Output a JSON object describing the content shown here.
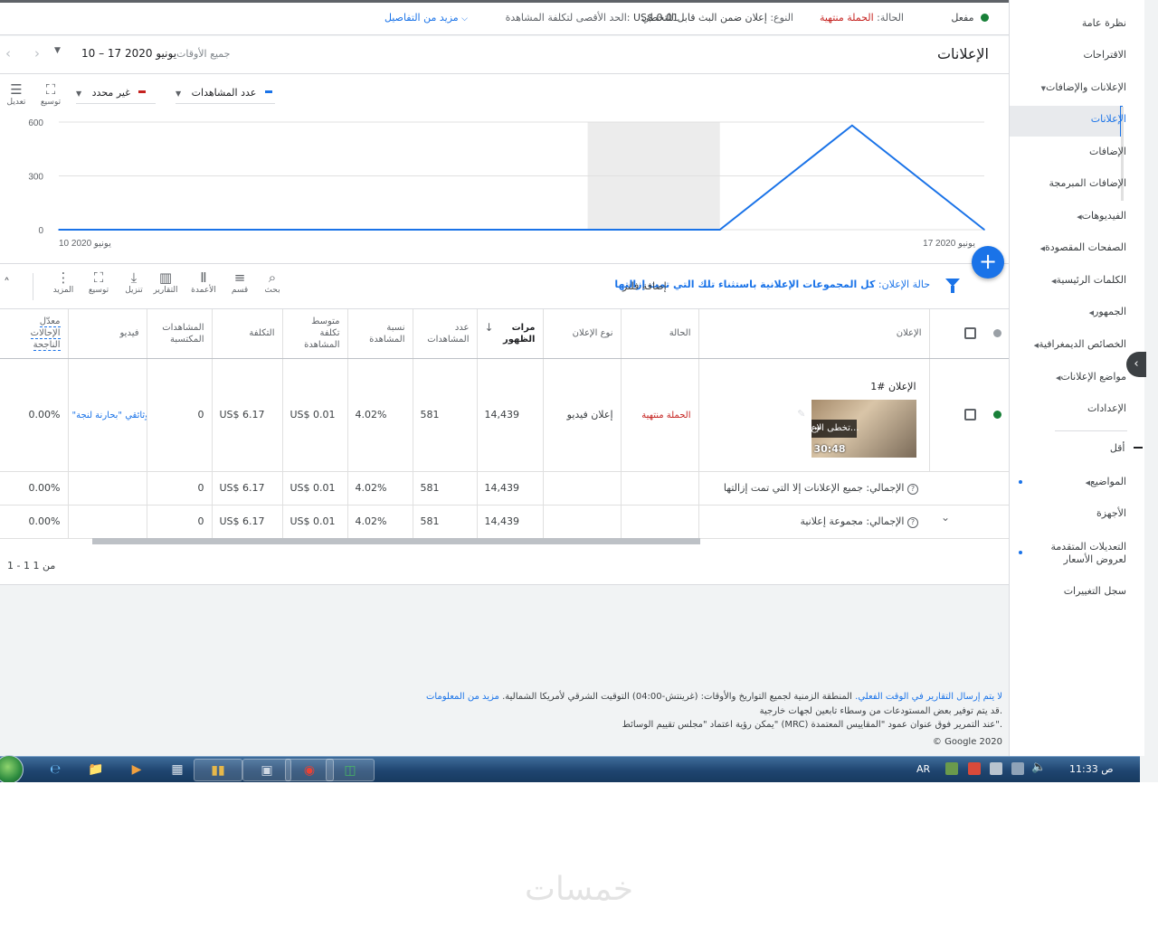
{
  "statusbar": {
    "status_label": "مفعل",
    "state_label": "الحالة:",
    "state_value": "الحملة منتهية",
    "type_label": "النوع:",
    "type_value": "إعلان ضمن البث قابل للتخطي",
    "max_cpv_label": "الحد الأقصى لتكلفة المشاهدة:",
    "max_cpv_value": "US$ 0.01",
    "more_details": "مزيد من التفاصيل"
  },
  "header": {
    "title": "الإعلانات",
    "date_preset": "جميع الأوقات",
    "date_range": "10 – 17 يونيو 2020"
  },
  "sidebar": {
    "items": [
      {
        "label": "نظرة عامة",
        "arrow": false
      },
      {
        "label": "الاقتراحات",
        "arrow": false
      },
      {
        "label": "الإعلانات والإضافات",
        "arrow": true
      },
      {
        "label": "الإعلانات",
        "arrow": false
      },
      {
        "label": "الإضافات",
        "arrow": false
      },
      {
        "label": "الإضافات المبرمجة",
        "arrow": false
      },
      {
        "label": "الفيديوهات",
        "arrow": true
      },
      {
        "label": "الصفحات المقصودة",
        "arrow": true
      },
      {
        "label": "الكلمات الرئيسية",
        "arrow": true
      },
      {
        "label": "الجمهور",
        "arrow": true
      },
      {
        "label": "الخصائص الديمغرافية",
        "arrow": true
      },
      {
        "label": "مواضع الإعلانات",
        "arrow": true
      },
      {
        "label": "الإعدادات",
        "arrow": false
      }
    ],
    "less": "أقل",
    "lower_items": [
      {
        "label": "المواضيع",
        "arrow": true
      },
      {
        "label": "الأجهزة",
        "arrow": false
      },
      {
        "label": "التعديلات المتقدمة",
        "arrow": false
      },
      {
        "label": "سجل التغييرات",
        "arrow": false
      }
    ],
    "advanced_line2": "لعروض الأسعار"
  },
  "chart_toolbar": {
    "metric1": "عدد المشاهدات",
    "metric1_color": "#1a73e8",
    "metric2": "غير محدد",
    "metric2_color": "#c5221f",
    "expand_label": "توسيع",
    "adjust_label": "تعديل"
  },
  "chart_data": {
    "type": "line",
    "x": [
      "10 يونيو 2020",
      "11 يونيو 2020",
      "12 يونيو 2020",
      "13 يونيو 2020",
      "14 يونيو 2020",
      "15 يونيو 2020",
      "16 يونيو 2020",
      "17 يونيو 2020"
    ],
    "series": [
      {
        "name": "عدد المشاهدات",
        "values": [
          0,
          0,
          0,
          0,
          0,
          0,
          581,
          0
        ]
      }
    ],
    "yticks": [
      0,
      300,
      600
    ],
    "ylim": [
      0,
      600
    ],
    "x_first_label": "10 يونيو 2020",
    "x_last_label": "17 يونيو 2020",
    "highlight_band": [
      "14 يونيو 2020",
      "15 يونيو 2020"
    ],
    "grid": true
  },
  "table_toolbar": {
    "filter_key": "حالة الإعلان:",
    "filter_value": "كل المجموعات الإعلانية باستثناء تلك التي تمت إزالتها",
    "add_filter": "إضافة فلتر",
    "tools": [
      {
        "label": "بحث",
        "icon": "search-icon"
      },
      {
        "label": "قسم",
        "icon": "segment-icon"
      },
      {
        "label": "الأعمدة",
        "icon": "columns-icon"
      },
      {
        "label": "التقارير",
        "icon": "reports-icon"
      },
      {
        "label": "تنزيل",
        "icon": "download-icon"
      },
      {
        "label": "توسيع",
        "icon": "expand-icon"
      },
      {
        "label": "المزيد",
        "icon": "more-icon"
      }
    ]
  },
  "table": {
    "columns": [
      "الإعلان",
      "الحالة",
      "نوع الإعلان",
      "مرات الظهور",
      "عدد المشاهدات",
      "نسبة المشاهدة",
      "متوسط تكلفة المشاهدة",
      "التكلفة",
      "المشاهدات المكتسبة",
      "فيديو",
      "معدّل الإحالات الناجحة"
    ],
    "row": {
      "ad_name": "الإعلان #1",
      "thumb_title": "تخطى الإع...",
      "thumb_duration": "30:48",
      "status": "الحملة منتهية",
      "ad_type": "إعلان فيديو",
      "impressions": "14,439",
      "views": "581",
      "view_rate": "4.02%",
      "avg_cpv": "US$ 0.01",
      "cost": "US$ 6.17",
      "earned_views": "0",
      "video": "\"وثائقي \"بحارنة لنجة",
      "conv_rate": "0.00%"
    },
    "totals": [
      {
        "label": "الإجمالي: جميع الإعلانات إلا التي تمت إزالتها",
        "impressions": "14,439",
        "views": "581",
        "view_rate": "4.02%",
        "avg_cpv": "US$ 0.01",
        "cost": "US$ 6.17",
        "earned_views": "0",
        "conv_rate": "0.00%"
      },
      {
        "label": "الإجمالي: مجموعة إعلانية",
        "impressions": "14,439",
        "views": "581",
        "view_rate": "4.02%",
        "avg_cpv": "US$ 0.01",
        "cost": "US$ 6.17",
        "earned_views": "0",
        "conv_rate": "0.00%"
      }
    ],
    "pager": "1 - 1 من 1"
  },
  "footer": {
    "line1_link": "لا يتم إرسال التقارير في الوقت الفعلي.",
    "line1_text": "المنطقة الزمنية لجميع التواريخ والأوقات: (غرينتش-04:00) التوقيت الشرقي لأمريكا الشمالية.",
    "line1_more": "مزيد من المعلومات",
    "line2": "قد يتم توفير بعض المستودعات من وسطاء تابعين لجهات خارجية.",
    "line3": "يمكن رؤية اعتماد \"مجلس تقييم الوسائط\" (MRC) عند التمرير فوق عنوان عمود \"المقاييس المعتمدة\".",
    "copyright": "© Google 2020"
  },
  "taskbar": {
    "lang": "AR",
    "time": "11:33",
    "ampm": "ص"
  },
  "watermark": "خمسات"
}
